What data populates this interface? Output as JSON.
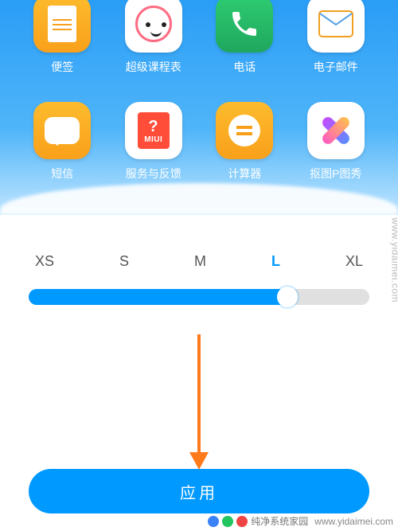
{
  "apps_row1": [
    {
      "label": "便签",
      "icon": "note-icon"
    },
    {
      "label": "超级课程表",
      "icon": "super-schedule-icon"
    },
    {
      "label": "电话",
      "icon": "phone-icon"
    },
    {
      "label": "电子邮件",
      "icon": "mail-icon"
    }
  ],
  "apps_row2": [
    {
      "label": "短信",
      "icon": "sms-icon"
    },
    {
      "label": "服务与反馈",
      "icon": "miui-feedback-icon",
      "badge": "MIUI"
    },
    {
      "label": "计算器",
      "icon": "calculator-icon"
    },
    {
      "label": "抠图P图秀",
      "icon": "cutout-icon"
    }
  ],
  "size_picker": {
    "options": [
      "XS",
      "S",
      "M",
      "L",
      "XL"
    ],
    "selected_index": 3,
    "fill_pct": 76
  },
  "apply_button_label": "应用",
  "watermark": {
    "text": "纯净系统家园",
    "host": "www.yidaimei.com"
  },
  "colors": {
    "accent": "#0099ff",
    "arrow": "#ff7a1a"
  }
}
